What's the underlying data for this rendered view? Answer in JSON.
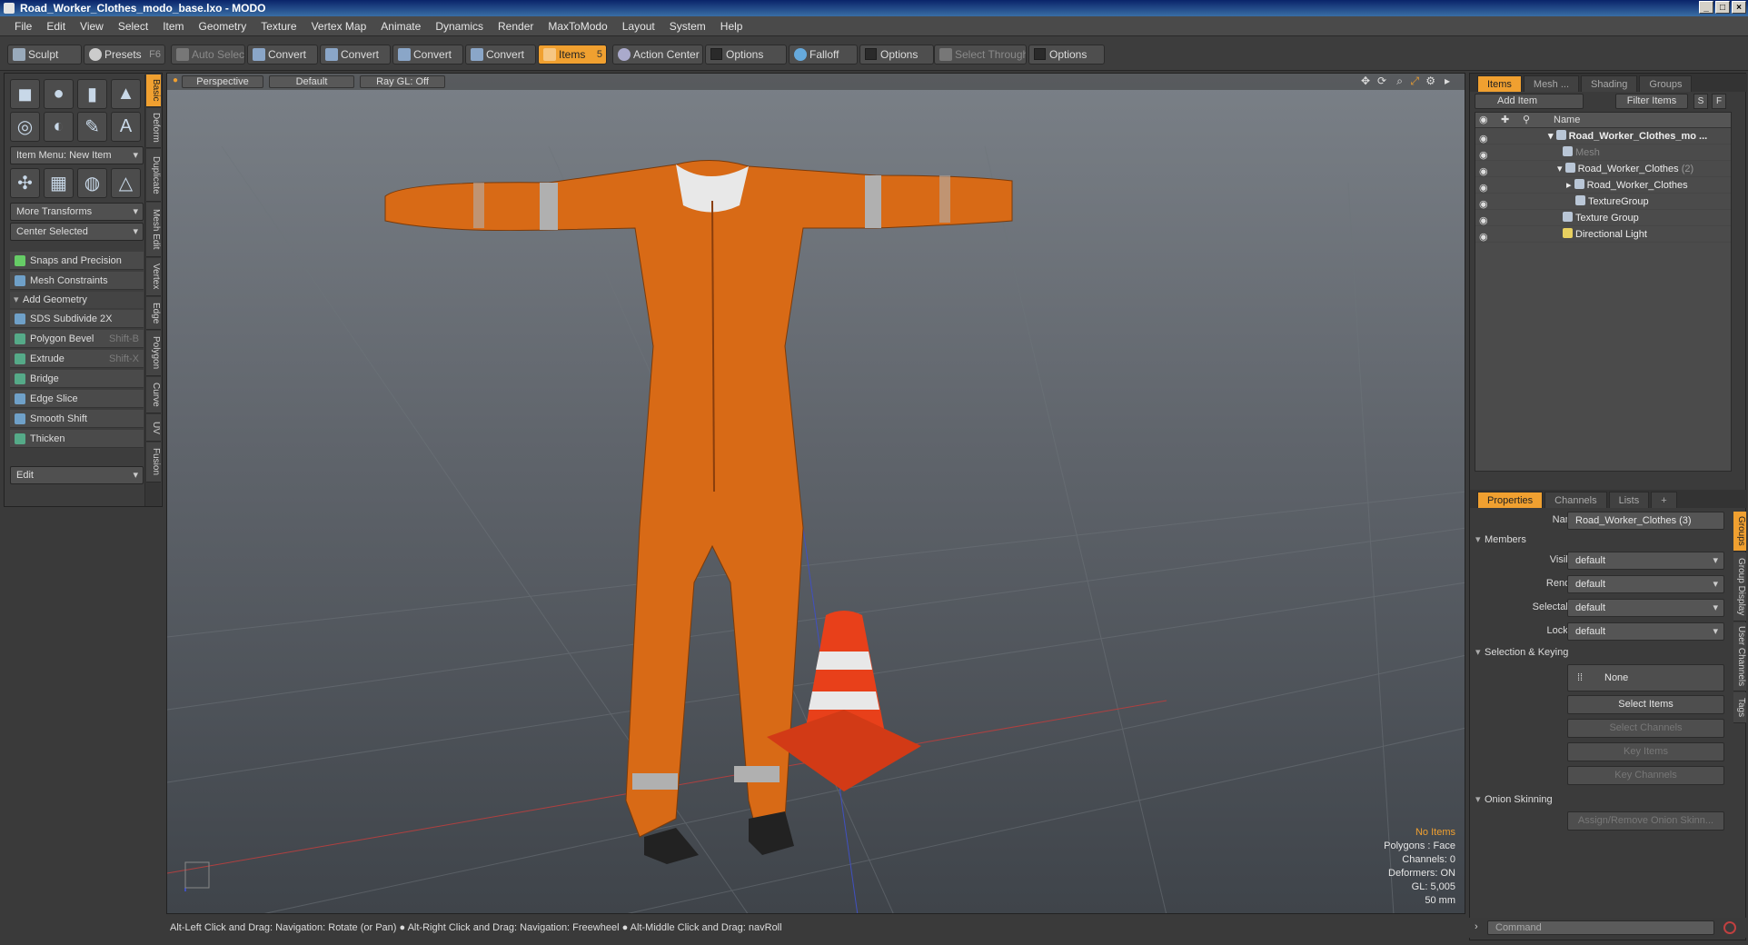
{
  "window": {
    "title": "Road_Worker_Clothes_modo_base.lxo - MODO"
  },
  "menu": [
    "File",
    "Edit",
    "View",
    "Select",
    "Item",
    "Geometry",
    "Texture",
    "Vertex Map",
    "Animate",
    "Dynamics",
    "Render",
    "MaxToModo",
    "Layout",
    "System",
    "Help"
  ],
  "toolbar": {
    "sculpt": "Sculpt",
    "presets": "Presets",
    "presets_key": "F6",
    "auto_select": "Auto Select",
    "convert": "Convert",
    "items": "Items",
    "items_key": "5",
    "action_center": "Action Center",
    "options": "Options",
    "falloff": "Falloff",
    "select_through": "Select Through"
  },
  "left": {
    "item_menu": "Item Menu: New Item",
    "more_transforms": "More Transforms",
    "center_selected": "Center Selected",
    "snaps": "Snaps and Precision",
    "mesh_constraints": "Mesh Constraints",
    "add_geometry": "Add Geometry",
    "tools": [
      {
        "label": "SDS Subdivide 2X",
        "key": ""
      },
      {
        "label": "Polygon Bevel",
        "key": "Shift-B"
      },
      {
        "label": "Extrude",
        "key": "Shift-X"
      },
      {
        "label": "Bridge",
        "key": ""
      },
      {
        "label": "Edge Slice",
        "key": ""
      },
      {
        "label": "Smooth Shift",
        "key": ""
      },
      {
        "label": "Thicken",
        "key": ""
      }
    ],
    "edit": "Edit",
    "vtabs": [
      "Basic",
      "Deform",
      "Duplicate",
      "Mesh Edit",
      "Vertex",
      "Edge",
      "Polygon",
      "Curve",
      "UV",
      "Fusion"
    ]
  },
  "viewport": {
    "perspective": "Perspective",
    "default": "Default",
    "raygl": "Ray GL: Off",
    "info": {
      "no_items": "No Items",
      "polygons": "Polygons : Face",
      "channels": "Channels: 0",
      "deformers": "Deformers: ON",
      "gl": "GL: 5,005",
      "scale": "50 mm"
    }
  },
  "status": "Alt-Left Click and Drag: Navigation: Rotate (or Pan) ● Alt-Right Click and Drag: Navigation: Freewheel ● Alt-Middle Click and Drag: navRoll",
  "items_panel": {
    "tabs": [
      "Items",
      "Mesh ...",
      "Shading",
      "Groups"
    ],
    "add_item": "Add Item",
    "filter_items": "Filter Items",
    "s_btn": "S",
    "f_btn": "F",
    "name_col": "Name",
    "rows": [
      {
        "label": "Road_Worker_Clothes_mo ...",
        "count": ""
      },
      {
        "label": "Mesh",
        "count": ""
      },
      {
        "label": "Road_Worker_Clothes",
        "count": "(2)"
      },
      {
        "label": "Road_Worker_Clothes",
        "count": ""
      },
      {
        "label": "TextureGroup",
        "count": ""
      },
      {
        "label": "Texture Group",
        "count": ""
      },
      {
        "label": "Directional Light",
        "count": ""
      }
    ]
  },
  "properties": {
    "tabs": [
      "Properties",
      "Channels",
      "Lists",
      "+"
    ],
    "name_label": "Name",
    "name_value": "Road_Worker_Clothes (3)",
    "members": "Members",
    "visible_label": "Visible",
    "render_label": "Render",
    "selectable_label": "Selectable",
    "locked_label": "Locked",
    "default_value": "default",
    "selection_keying": "Selection & Keying",
    "none": "None",
    "select_items": "Select Items",
    "select_channels": "Select Channels",
    "key_items": "Key Items",
    "key_channels": "Key Channels",
    "onion": "Onion Skinning",
    "assign": "Assign/Remove Onion Skinn...",
    "vtabs": [
      "Groups",
      "Group Display",
      "User Channels",
      "Tags"
    ]
  },
  "command": {
    "placeholder": "Command"
  }
}
